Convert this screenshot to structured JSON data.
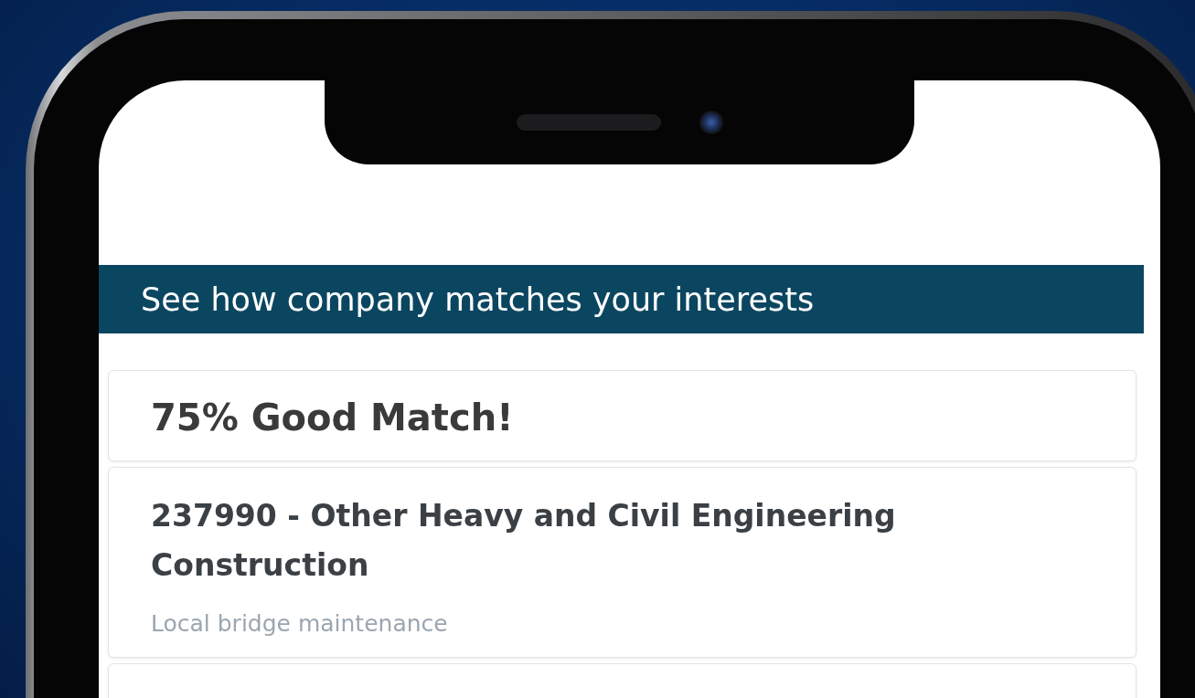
{
  "header": {
    "title": "See how company matches your interests"
  },
  "match": {
    "title": "75% Good Match!"
  },
  "industries": [
    {
      "title": "237990 - Other Heavy and Civil Engineering Construction",
      "description": "Local bridge maintenance"
    }
  ]
}
